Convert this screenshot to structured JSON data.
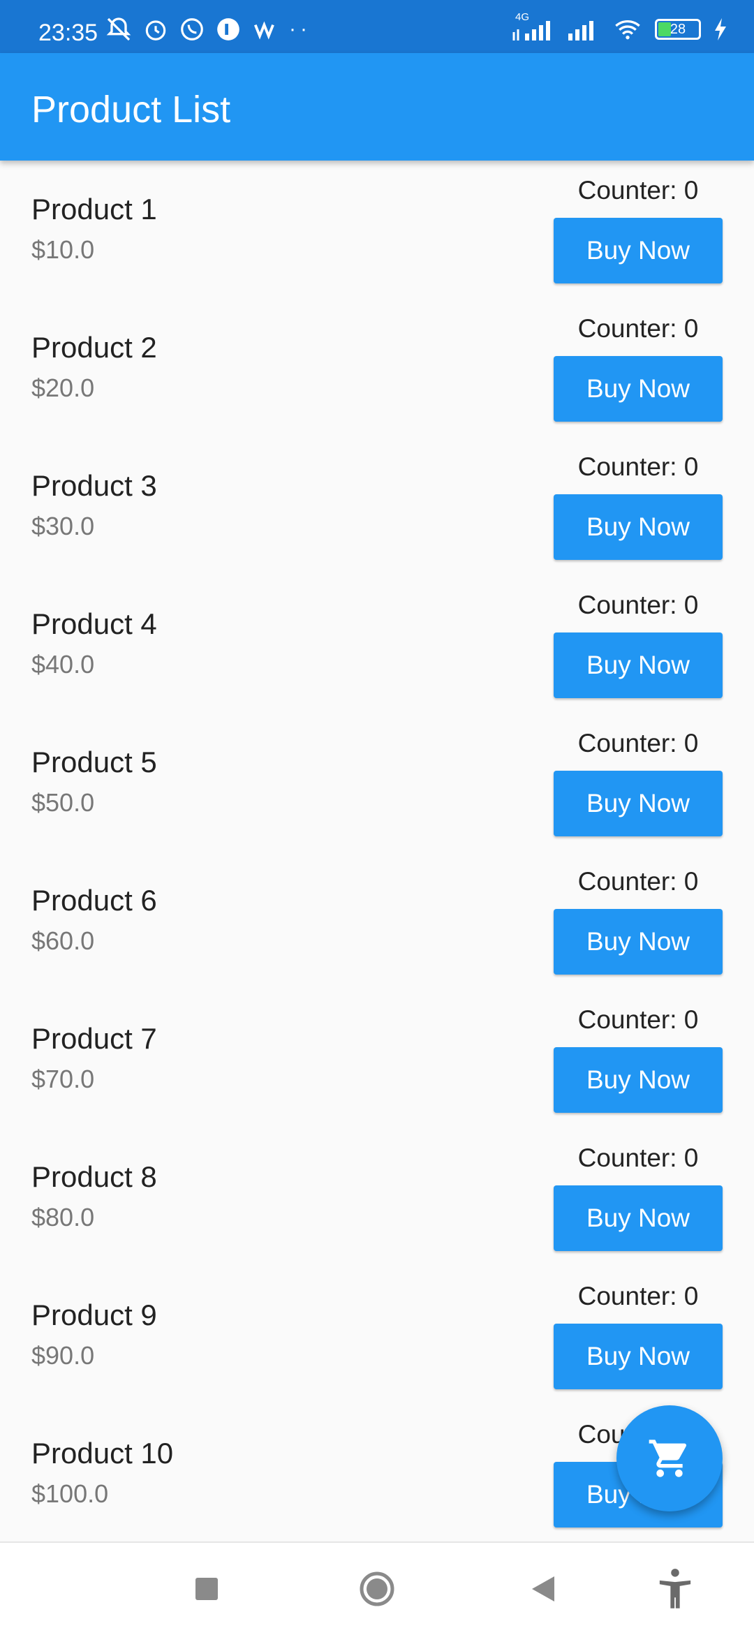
{
  "status_bar": {
    "time": "23:35",
    "network": "4G",
    "battery": "28"
  },
  "app_bar": {
    "title": "Product List"
  },
  "products": [
    {
      "name": "Product 1",
      "price": "$10.0",
      "counter": "Counter: 0",
      "button": "Buy Now"
    },
    {
      "name": "Product 2",
      "price": "$20.0",
      "counter": "Counter: 0",
      "button": "Buy Now"
    },
    {
      "name": "Product 3",
      "price": "$30.0",
      "counter": "Counter: 0",
      "button": "Buy Now"
    },
    {
      "name": "Product 4",
      "price": "$40.0",
      "counter": "Counter: 0",
      "button": "Buy Now"
    },
    {
      "name": "Product 5",
      "price": "$50.0",
      "counter": "Counter: 0",
      "button": "Buy Now"
    },
    {
      "name": "Product 6",
      "price": "$60.0",
      "counter": "Counter: 0",
      "button": "Buy Now"
    },
    {
      "name": "Product 7",
      "price": "$70.0",
      "counter": "Counter: 0",
      "button": "Buy Now"
    },
    {
      "name": "Product 8",
      "price": "$80.0",
      "counter": "Counter: 0",
      "button": "Buy Now"
    },
    {
      "name": "Product 9",
      "price": "$90.0",
      "counter": "Counter: 0",
      "button": "Buy Now"
    },
    {
      "name": "Product 10",
      "price": "$100.0",
      "counter": "Counter: 0",
      "button": "Buy Now"
    }
  ],
  "fab": {
    "icon": "shopping-cart-icon"
  },
  "colors": {
    "status_bar": "#1976d2",
    "app_bar": "#2196f3",
    "button": "#2196f3",
    "background": "#fafafa"
  }
}
